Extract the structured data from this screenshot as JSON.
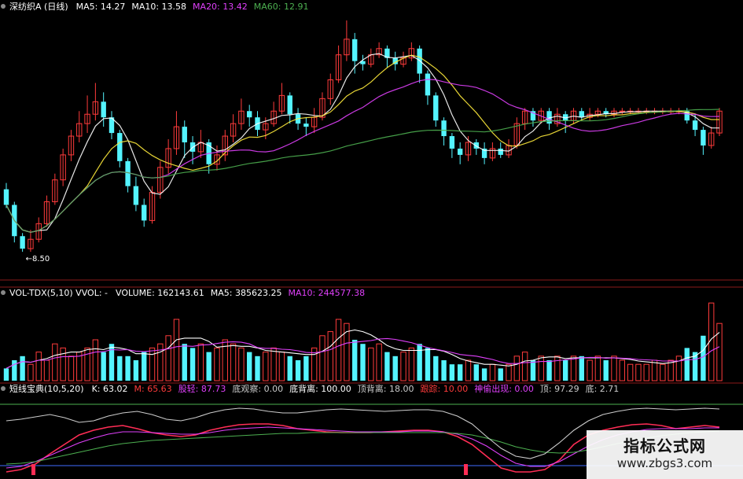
{
  "chart_data": [
    {
      "type": "candlestick",
      "header": {
        "title": "深纺织A (日线)",
        "indicators": [
          {
            "label": "MA5: 14.27",
            "color": "#ffffff"
          },
          {
            "label": "MA10: 13.58",
            "color": "#ffffff"
          },
          {
            "label": "MA20: 13.42",
            "color": "#e040fb"
          },
          {
            "label": "MA60: 12.91",
            "color": "#4caf50"
          }
        ]
      },
      "price_range": [
        8.0,
        16.0
      ],
      "low_marker": "8.50",
      "bars": [
        [
          10.5,
          10.0,
          10.7,
          9.9
        ],
        [
          10.0,
          9.0,
          10.1,
          8.8
        ],
        [
          9.0,
          8.6,
          9.1,
          8.5
        ],
        [
          8.6,
          8.9,
          9.2,
          8.5
        ],
        [
          8.9,
          9.4,
          9.6,
          8.8
        ],
        [
          9.4,
          10.1,
          10.3,
          9.3
        ],
        [
          10.1,
          10.8,
          11.0,
          10.0
        ],
        [
          10.8,
          11.6,
          11.8,
          10.6
        ],
        [
          11.6,
          12.2,
          12.4,
          11.4
        ],
        [
          12.2,
          12.6,
          13.0,
          12.0
        ],
        [
          12.6,
          12.9,
          13.5,
          12.3
        ],
        [
          12.9,
          13.3,
          13.9,
          12.7
        ],
        [
          13.3,
          12.8,
          13.6,
          12.5
        ],
        [
          12.8,
          12.3,
          13.0,
          12.1
        ],
        [
          12.3,
          11.4,
          12.4,
          11.2
        ],
        [
          11.4,
          10.6,
          11.5,
          10.4
        ],
        [
          10.6,
          10.0,
          10.9,
          9.8
        ],
        [
          10.0,
          9.5,
          10.2,
          9.3
        ],
        [
          9.5,
          10.4,
          10.6,
          9.4
        ],
        [
          10.4,
          11.2,
          11.4,
          10.2
        ],
        [
          11.2,
          11.8,
          12.1,
          11.0
        ],
        [
          11.8,
          12.5,
          13.0,
          11.6
        ],
        [
          12.5,
          12.0,
          12.7,
          11.5
        ],
        [
          12.0,
          11.7,
          12.2,
          11.3
        ],
        [
          11.7,
          12.0,
          12.4,
          11.5
        ],
        [
          12.0,
          11.3,
          12.1,
          11.0
        ],
        [
          11.3,
          11.6,
          11.9,
          11.1
        ],
        [
          11.6,
          12.2,
          12.4,
          11.4
        ],
        [
          12.2,
          12.6,
          12.9,
          12.0
        ],
        [
          12.6,
          13.0,
          13.4,
          12.4
        ],
        [
          13.0,
          12.8,
          13.2,
          12.5
        ],
        [
          12.8,
          12.4,
          13.0,
          12.2
        ],
        [
          12.4,
          12.6,
          12.8,
          12.1
        ],
        [
          12.6,
          13.0,
          13.3,
          12.5
        ],
        [
          13.0,
          13.5,
          13.9,
          12.9
        ],
        [
          13.5,
          12.9,
          13.6,
          12.6
        ],
        [
          12.9,
          12.6,
          13.1,
          12.4
        ],
        [
          12.6,
          12.5,
          12.8,
          12.2
        ],
        [
          12.5,
          12.8,
          13.1,
          12.3
        ],
        [
          12.8,
          13.4,
          13.6,
          12.7
        ],
        [
          13.4,
          14.0,
          14.2,
          13.2
        ],
        [
          14.0,
          14.8,
          15.1,
          13.9
        ],
        [
          14.8,
          15.3,
          15.9,
          14.6
        ],
        [
          15.3,
          14.6,
          15.5,
          14.2
        ],
        [
          14.6,
          14.5,
          14.8,
          14.3
        ],
        [
          14.5,
          14.8,
          15.0,
          14.4
        ],
        [
          14.8,
          15.0,
          15.2,
          14.7
        ],
        [
          15.0,
          14.7,
          15.1,
          14.4
        ],
        [
          14.7,
          14.5,
          14.9,
          14.3
        ],
        [
          14.5,
          14.7,
          14.9,
          14.4
        ],
        [
          14.7,
          15.0,
          15.2,
          14.6
        ],
        [
          15.0,
          14.2,
          15.1,
          13.9
        ],
        [
          14.2,
          13.5,
          14.3,
          13.2
        ],
        [
          13.5,
          12.7,
          13.6,
          12.5
        ],
        [
          12.7,
          12.2,
          12.8,
          11.9
        ],
        [
          12.2,
          11.8,
          12.3,
          11.5
        ],
        [
          11.8,
          11.6,
          12.0,
          11.3
        ],
        [
          11.6,
          12.0,
          12.2,
          11.4
        ],
        [
          12.0,
          11.8,
          12.1,
          11.6
        ],
        [
          11.8,
          11.5,
          12.0,
          11.3
        ],
        [
          11.5,
          11.8,
          12.0,
          11.4
        ],
        [
          11.8,
          11.6,
          12.0,
          11.5
        ],
        [
          11.6,
          11.9,
          12.1,
          11.5
        ],
        [
          11.9,
          12.6,
          12.8,
          11.8
        ],
        [
          12.6,
          13.0,
          13.1,
          12.4
        ],
        [
          13.0,
          12.7,
          13.1,
          12.5
        ],
        [
          12.7,
          13.0,
          13.1,
          12.6
        ],
        [
          13.0,
          12.6,
          13.1,
          12.4
        ],
        [
          12.6,
          12.9,
          13.1,
          12.5
        ],
        [
          12.9,
          12.7,
          13.0,
          12.3
        ],
        [
          12.7,
          13.0,
          13.1,
          12.6
        ],
        [
          13.0,
          12.8,
          13.1,
          12.7
        ],
        [
          12.8,
          12.9,
          13.1,
          12.7
        ],
        [
          12.9,
          13.0,
          13.1,
          12.8
        ],
        [
          13.0,
          12.9,
          13.1,
          12.8
        ],
        [
          12.9,
          13.0,
          13.1,
          12.8
        ],
        [
          13.0,
          13.0,
          13.1,
          12.9
        ],
        [
          13.0,
          13.0,
          13.1,
          12.9
        ],
        [
          13.0,
          13.0,
          13.1,
          12.9
        ],
        [
          13.0,
          13.0,
          13.1,
          12.9
        ],
        [
          13.0,
          13.0,
          13.1,
          12.9
        ],
        [
          13.0,
          13.0,
          13.1,
          12.9
        ],
        [
          13.0,
          13.0,
          13.1,
          12.9
        ],
        [
          13.0,
          13.0,
          13.1,
          12.9
        ],
        [
          13.0,
          12.7,
          13.1,
          12.6
        ],
        [
          12.7,
          12.4,
          12.9,
          12.2
        ],
        [
          12.4,
          11.9,
          12.5,
          11.6
        ],
        [
          11.9,
          12.3,
          12.5,
          11.8
        ],
        [
          12.3,
          13.0,
          13.1,
          12.2
        ]
      ],
      "ma_lines": [
        {
          "name": "MA5",
          "color": "#ffffff"
        },
        {
          "name": "MA10",
          "color": "#ffeb3b"
        },
        {
          "name": "MA20",
          "color": "#e040fb"
        },
        {
          "name": "MA60",
          "color": "#4caf50"
        }
      ]
    },
    {
      "type": "bar",
      "header": {
        "title": "VOL-TDX(5,10) VVOL: -",
        "indicators": [
          {
            "label": "VOLUME: 162143.61",
            "color": "#ffffff"
          },
          {
            "label": "MA5: 385623.25",
            "color": "#ffffff"
          },
          {
            "label": "MA10: 244577.38",
            "color": "#e040fb"
          }
        ]
      },
      "volume_ratio": [
        0.15,
        0.25,
        0.3,
        0.2,
        0.35,
        0.25,
        0.45,
        0.4,
        0.3,
        0.35,
        0.4,
        0.5,
        0.35,
        0.45,
        0.3,
        0.3,
        0.25,
        0.35,
        0.4,
        0.45,
        0.55,
        0.75,
        0.45,
        0.4,
        0.45,
        0.35,
        0.4,
        0.5,
        0.45,
        0.4,
        0.35,
        0.3,
        0.35,
        0.4,
        0.35,
        0.3,
        0.25,
        0.3,
        0.4,
        0.55,
        0.6,
        0.75,
        0.7,
        0.5,
        0.45,
        0.4,
        0.45,
        0.35,
        0.3,
        0.35,
        0.4,
        0.45,
        0.4,
        0.3,
        0.25,
        0.2,
        0.2,
        0.25,
        0.2,
        0.15,
        0.2,
        0.15,
        0.2,
        0.3,
        0.35,
        0.25,
        0.3,
        0.25,
        0.3,
        0.25,
        0.3,
        0.3,
        0.25,
        0.3,
        0.25,
        0.3,
        0.25,
        0.2,
        0.2,
        0.2,
        0.25,
        0.2,
        0.25,
        0.3,
        0.4,
        0.35,
        0.55,
        0.95,
        0.7
      ]
    },
    {
      "type": "line",
      "header": {
        "title": "短线宝典(10,5,20)",
        "indicators": [
          {
            "label": "K: 63.02",
            "color": "#ffffff"
          },
          {
            "label": "M: 65.63",
            "color": "#ff3b3b"
          },
          {
            "label": "股轻: 87.73",
            "color": "#e040fb"
          },
          {
            "label": "底观察: 0.00",
            "color": "#cccccc"
          },
          {
            "label": "底背离: 100.00",
            "color": "#ffffff"
          },
          {
            "label": "顶背离: 18.00",
            "color": "#cccccc"
          },
          {
            "label": "跟踪: 10.00",
            "color": "#ff3b3b"
          },
          {
            "label": "神偷出现: 0.00",
            "color": "#e040fb"
          },
          {
            "label": "顶: 97.29",
            "color": "#cccccc"
          },
          {
            "label": "底: 2.71",
            "color": "#cccccc"
          }
        ]
      },
      "series": [
        {
          "color": "#ff2d55",
          "values": [
            5,
            8,
            15,
            28,
            40,
            52,
            58,
            62,
            64,
            60,
            55,
            52,
            50,
            52,
            58,
            62,
            65,
            66,
            66,
            64,
            60,
            58,
            56,
            55,
            55,
            55,
            56,
            57,
            58,
            58,
            56,
            50,
            40,
            25,
            10,
            5,
            5,
            8,
            20,
            40,
            52,
            58,
            62,
            65,
            66,
            64,
            60,
            62,
            64,
            62
          ]
        },
        {
          "color": "#e040fb",
          "values": [
            10,
            12,
            18,
            26,
            34,
            42,
            48,
            53,
            56,
            56,
            55,
            54,
            53,
            53,
            55,
            58,
            60,
            61,
            62,
            61,
            60,
            59,
            58,
            57,
            56,
            56,
            56,
            56,
            57,
            57,
            56,
            53,
            47,
            38,
            26,
            16,
            12,
            12,
            18,
            28,
            38,
            46,
            52,
            56,
            59,
            60,
            60,
            60,
            61,
            61
          ]
        },
        {
          "color": "#4caf50",
          "values": [
            15,
            16,
            18,
            22,
            26,
            30,
            34,
            38,
            41,
            43,
            45,
            46,
            47,
            48,
            49,
            50,
            51,
            52,
            53,
            54,
            54,
            55,
            55,
            55,
            55,
            55,
            55,
            55,
            55,
            55,
            55,
            54,
            52,
            48,
            43,
            37,
            33,
            30,
            29,
            30,
            33,
            37,
            41,
            45,
            48,
            51,
            53,
            55,
            56,
            57
          ]
        },
        {
          "color": "#cccccc",
          "values": [
            70,
            72,
            75,
            78,
            74,
            68,
            70,
            76,
            80,
            82,
            78,
            72,
            70,
            74,
            80,
            84,
            86,
            85,
            82,
            80,
            80,
            82,
            84,
            85,
            84,
            83,
            82,
            83,
            84,
            84,
            82,
            76,
            66,
            50,
            35,
            25,
            22,
            28,
            42,
            58,
            70,
            78,
            82,
            85,
            86,
            85,
            84,
            85,
            86,
            85
          ]
        }
      ]
    }
  ],
  "watermark": {
    "title": "指标公式网",
    "url": "www.zbgs3.com"
  }
}
